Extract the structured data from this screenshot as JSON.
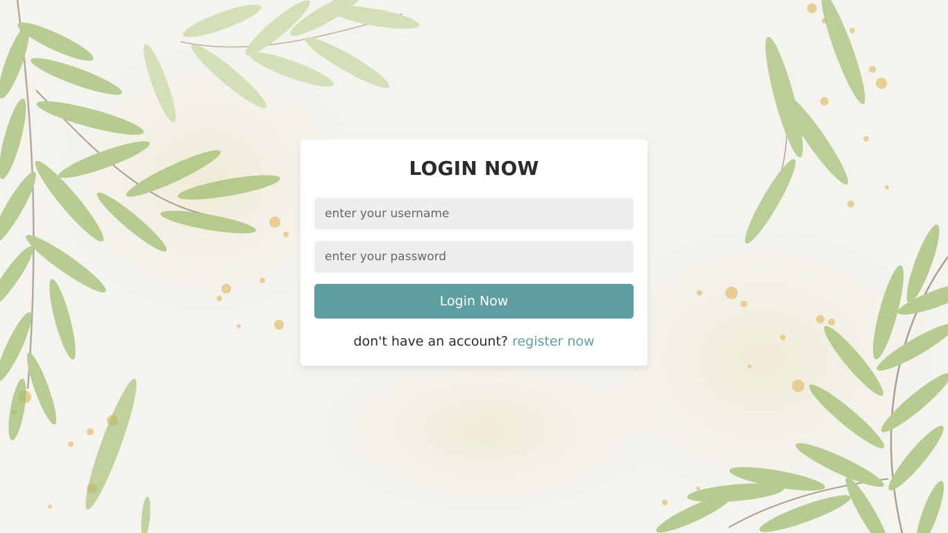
{
  "login_form": {
    "title": "LOGIN NOW",
    "username_placeholder": "enter your username",
    "password_placeholder": "enter your password",
    "submit_label": "Login Now",
    "register_prompt": "don't have an account?",
    "register_link": "register now"
  },
  "colors": {
    "accent": "#5f9ea0",
    "card_background": "#ffffff",
    "input_background": "#eeeeee",
    "page_background": "#f4f3ee",
    "leaf_green": "#9dbb6a"
  },
  "background": {
    "decoration": "watercolor-leaves"
  }
}
